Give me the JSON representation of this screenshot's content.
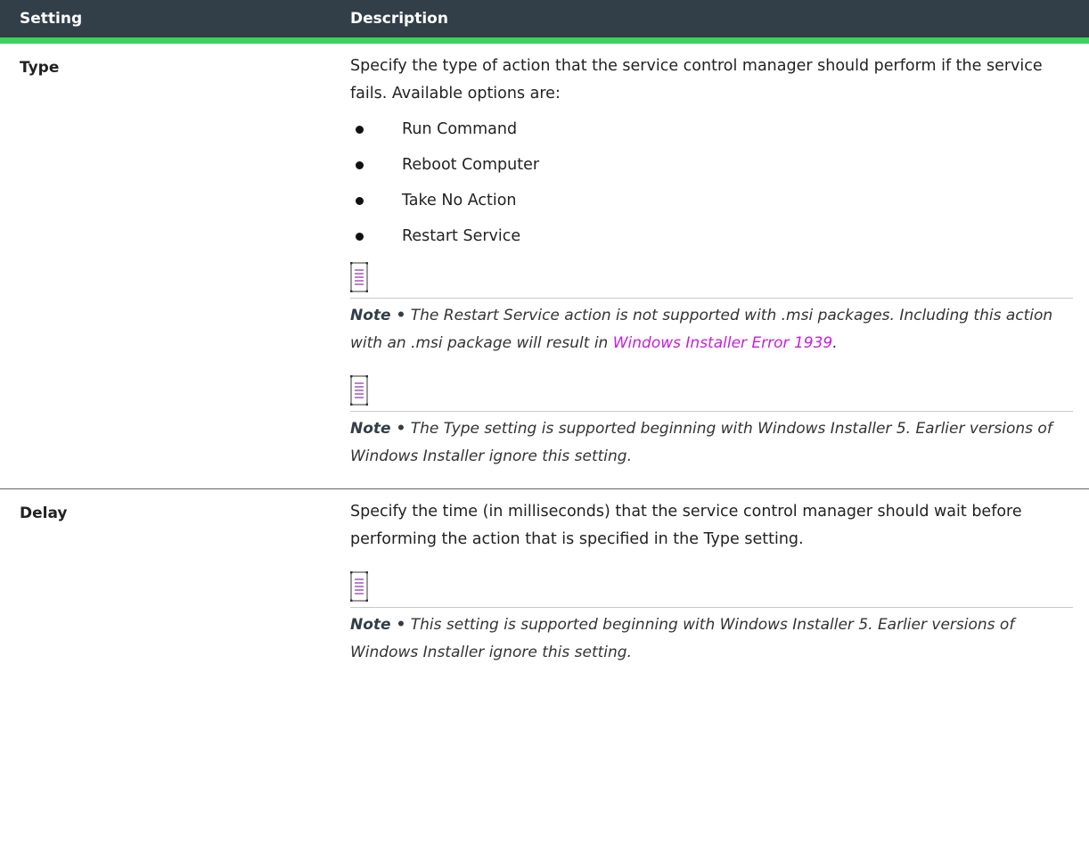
{
  "table": {
    "headers": {
      "setting": "Setting",
      "description": "Description"
    },
    "rows": [
      {
        "setting": "Type",
        "description": "Specify the type of action that the service control manager should perform if the service fails. Available options are:",
        "options": [
          "Run Command",
          "Reboot Computer",
          "Take No Action",
          "Restart Service"
        ],
        "notes": [
          {
            "label": "Note •",
            "text_before_link": " The Restart Service action is not supported with .msi packages. Including this action with an .msi package will result in ",
            "link_text": "Windows Installer Error 1939",
            "text_after_link": "."
          },
          {
            "label": "Note •",
            "text": " The Type setting is supported beginning with Windows Installer 5. Earlier versions of Windows Installer ignore this setting."
          }
        ]
      },
      {
        "setting": "Delay",
        "description": "Specify the time (in milliseconds) that the service control manager should wait before performing the action that is specified in the Type setting.",
        "notes": [
          {
            "label": "Note •",
            "text": " This setting is supported beginning with Windows Installer 5. Earlier versions of Windows Installer ignore this setting."
          }
        ]
      }
    ]
  },
  "colors": {
    "header_bg": "#323e48",
    "header_accent": "#3ad35c",
    "link": "#c51fd9",
    "note_icon": "#8a2ea8"
  },
  "icons": {
    "note": "note-icon"
  }
}
